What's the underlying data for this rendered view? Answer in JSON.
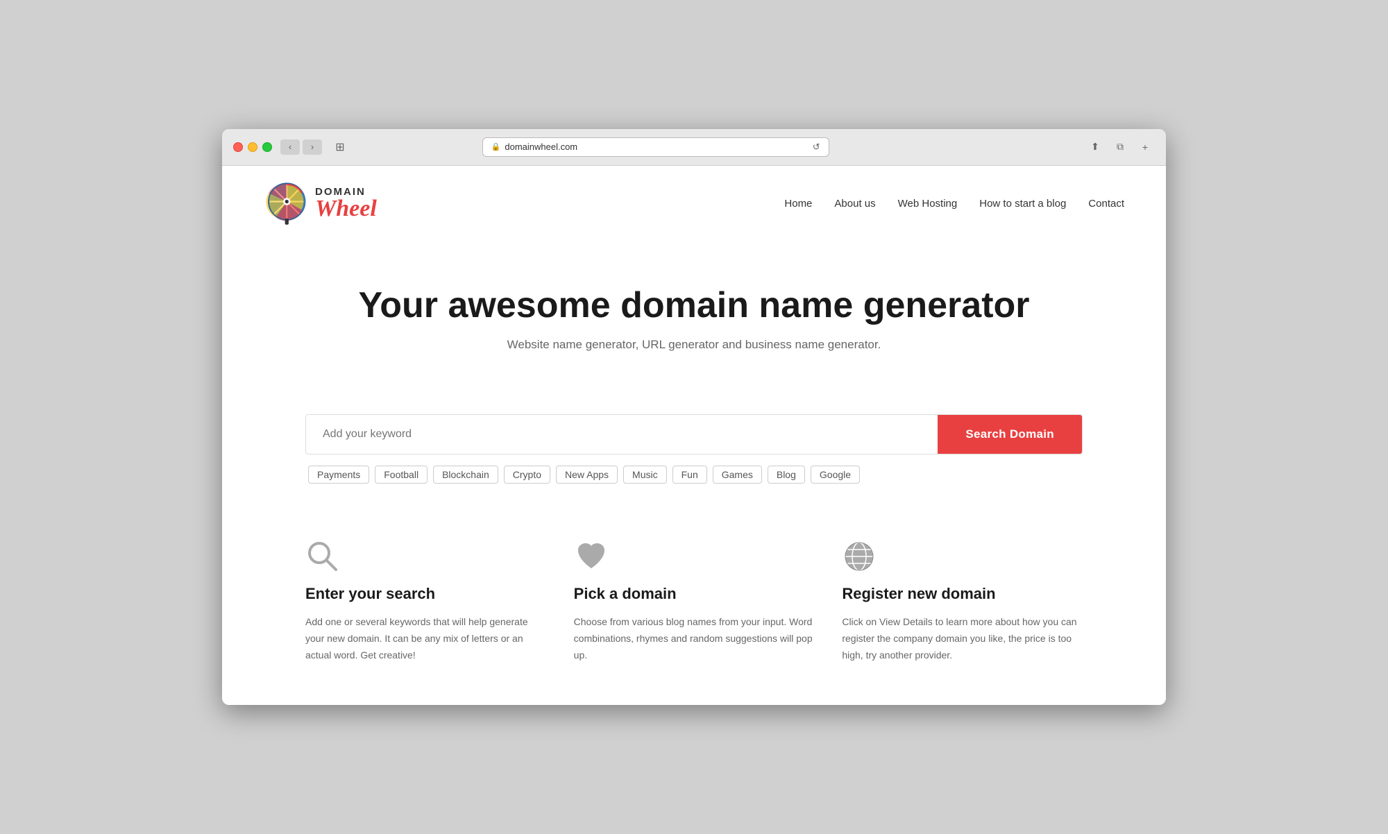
{
  "browser": {
    "url": "domainwheel.com",
    "traffic_lights": [
      "red",
      "yellow",
      "green"
    ]
  },
  "nav": {
    "items": [
      {
        "label": "Home",
        "id": "home"
      },
      {
        "label": "About us",
        "id": "about"
      },
      {
        "label": "Web Hosting",
        "id": "hosting"
      },
      {
        "label": "How to start a blog",
        "id": "blog"
      },
      {
        "label": "Contact",
        "id": "contact"
      }
    ]
  },
  "logo": {
    "domain": "DOMAIN",
    "wheel": "Wheel"
  },
  "hero": {
    "title": "Your awesome domain name generator",
    "subtitle": "Website name generator, URL generator and business name generator."
  },
  "search": {
    "placeholder": "Add your keyword",
    "button_label": "Search Domain"
  },
  "keywords": [
    "Payments",
    "Football",
    "Blockchain",
    "Crypto",
    "New Apps",
    "Music",
    "Fun",
    "Games",
    "Blog",
    "Google"
  ],
  "features": [
    {
      "icon": "search",
      "title": "Enter your search",
      "desc": "Add one or several keywords that will help generate your new domain. It can be any mix of letters or an actual word. Get creative!"
    },
    {
      "icon": "heart",
      "title": "Pick a domain",
      "desc": "Choose from various blog names from your input. Word combinations, rhymes and random suggestions will pop up."
    },
    {
      "icon": "globe",
      "title": "Register new domain",
      "desc": "Click on View Details to learn more about how you can register the company domain you like, the price is too high, try another provider."
    }
  ]
}
